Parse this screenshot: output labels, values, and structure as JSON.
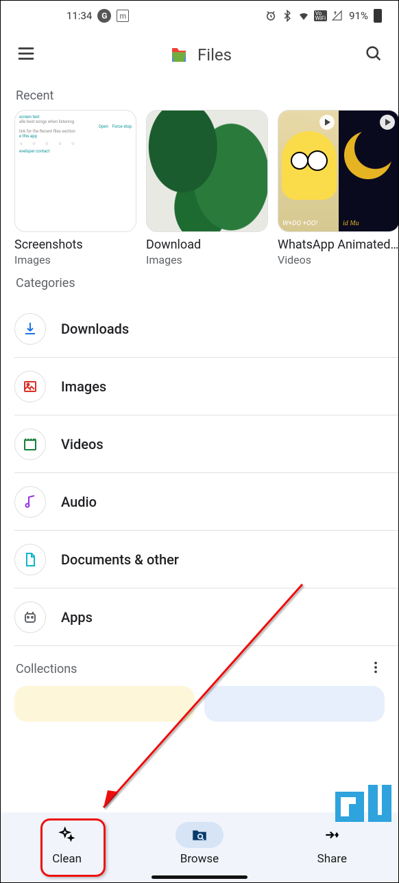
{
  "status": {
    "time": "11:34",
    "battery": "91%"
  },
  "header": {
    "title": "Files"
  },
  "sections": {
    "recent": "Recent",
    "categories": "Categories",
    "collections": "Collections"
  },
  "recent": [
    {
      "title": "Screenshots",
      "subtitle": "Images"
    },
    {
      "title": "Download",
      "subtitle": "Images"
    },
    {
      "title": "WhatsApp Animated...",
      "subtitle": "Videos"
    }
  ],
  "categories": [
    {
      "label": "Downloads"
    },
    {
      "label": "Images"
    },
    {
      "label": "Videos"
    },
    {
      "label": "Audio"
    },
    {
      "label": "Documents & other"
    },
    {
      "label": "Apps"
    }
  ],
  "nav": {
    "clean": "Clean",
    "browse": "Browse",
    "share": "Share"
  }
}
